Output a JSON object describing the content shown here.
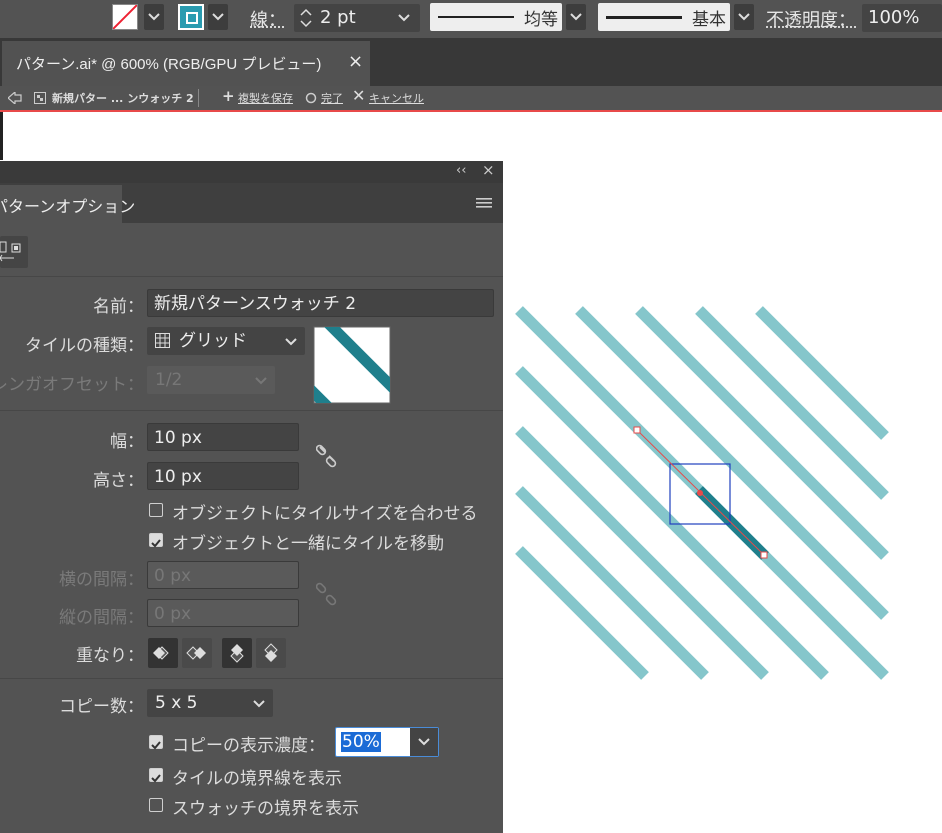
{
  "control_bar": {
    "stroke_label": "線：",
    "stroke_value": "2 pt",
    "profile_label": "均等",
    "brush_label": "基本",
    "opacity_label": "不透明度：",
    "opacity_value": "100%"
  },
  "document_tab": {
    "title": "パターン.ai* @ 600% (RGB/GPU プレビュー)",
    "close": "×"
  },
  "isolation_bar": {
    "back_icon": "back-arrow-icon",
    "breadcrumb": "新規パター ... ンウォッチ 2",
    "save_copy": "複製を保存",
    "done": "完了",
    "cancel": "キャンセル"
  },
  "panel": {
    "collapse": "‹‹",
    "close": "×",
    "tab_label": "パターンオプション",
    "menu_icon": "hamburger-icon",
    "name_label": "名前：",
    "name_value": "新規パターンスウォッチ 2",
    "tile_type_label": "タイルの種類：",
    "tile_type_value": "グリッド",
    "brick_offset_label": "レンガオフセット：",
    "brick_offset_value": "1/2",
    "width_label": "幅：",
    "width_value": "10 px",
    "height_label": "高さ：",
    "height_value": "10 px",
    "fit_tile_label": "オブジェクトにタイルサイズを合わせる",
    "move_tile_label": "オブジェクトと一緒にタイルを移動",
    "h_spacing_label": "横の間隔：",
    "h_spacing_value": "0 px",
    "v_spacing_label": "縦の間隔：",
    "v_spacing_value": "0 px",
    "overlap_label": "重なり：",
    "copies_label": "コピー数：",
    "copies_value": "5 x 5",
    "dim_copies_label": "コピーの表示濃度：",
    "dim_copies_value": "50%",
    "show_tile_edge_label": "タイルの境界線を表示",
    "show_swatch_bounds_label": "スウォッチの境界を表示",
    "checkbox_states": {
      "fit_tile": false,
      "move_tile": true,
      "dim_copies": true,
      "show_tile_edge": true,
      "show_swatch_bounds": false
    }
  },
  "colors": {
    "pattern_stripe": "#85c6cb",
    "pattern_stripe_dark": "#1f7f8c",
    "tile_bounds": "#1f3fbf",
    "selection": "#e84a4a"
  }
}
